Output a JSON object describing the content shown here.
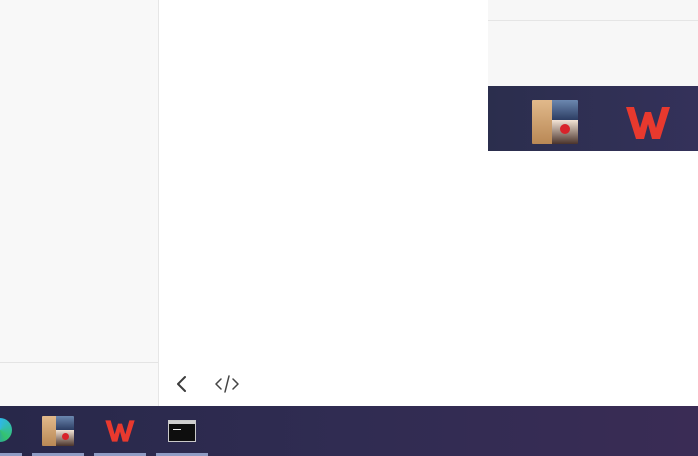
{
  "window": {
    "toolbar": {
      "back_icon": "chevron-left-icon",
      "code_icon": "code-icon"
    }
  },
  "overlay_preview": {
    "icons": [
      "photos-app-icon",
      "wps-office-icon"
    ]
  },
  "taskbar": {
    "items": [
      {
        "name": "edge-icon",
        "pinned": true
      },
      {
        "name": "photos-app-icon",
        "running": true
      },
      {
        "name": "wps-office-icon",
        "running": true
      },
      {
        "name": "terminal-icon",
        "running": true
      }
    ],
    "accent_color": "#8f9cc4"
  },
  "colors": {
    "wps_red": "#e8392e",
    "taskbar_bg": "#2e2c50"
  }
}
